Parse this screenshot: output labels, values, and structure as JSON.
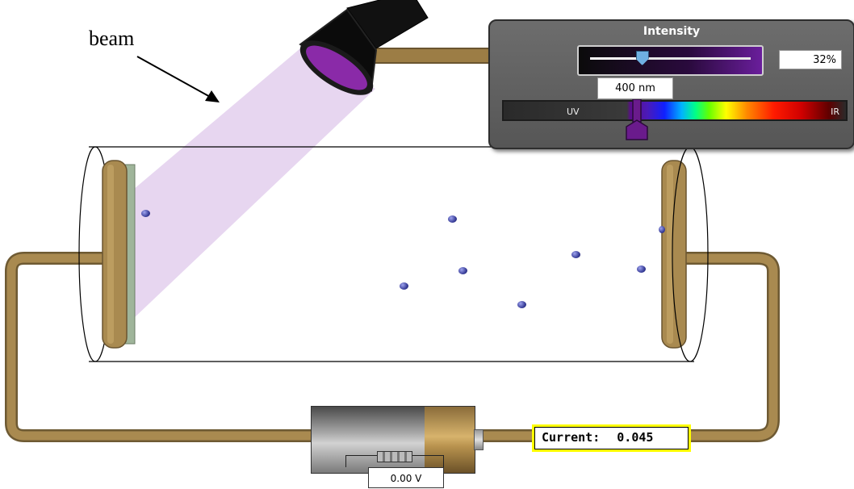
{
  "annotation": {
    "beam_label": "beam"
  },
  "intensity_panel": {
    "title": "Intensity",
    "intensity_value": "32%",
    "intensity_percent": 32,
    "wavelength_value": "400 nm",
    "spectrum_left_label": "UV",
    "spectrum_right_label": "IR"
  },
  "battery": {
    "voltage_value": "0.00 V"
  },
  "ammeter": {
    "label": "Current:",
    "value": "0.045"
  },
  "colors": {
    "beam": "#e6d4ef",
    "lamp_lens": "#8a2aa8",
    "wire": "#9c7d45",
    "current_border": "#ffff00",
    "wavelength_marker": "#6a1b8c"
  },
  "icons": [
    "light-source-icon",
    "wavelength-marker-icon",
    "electron-icon"
  ],
  "electron_count": 9
}
